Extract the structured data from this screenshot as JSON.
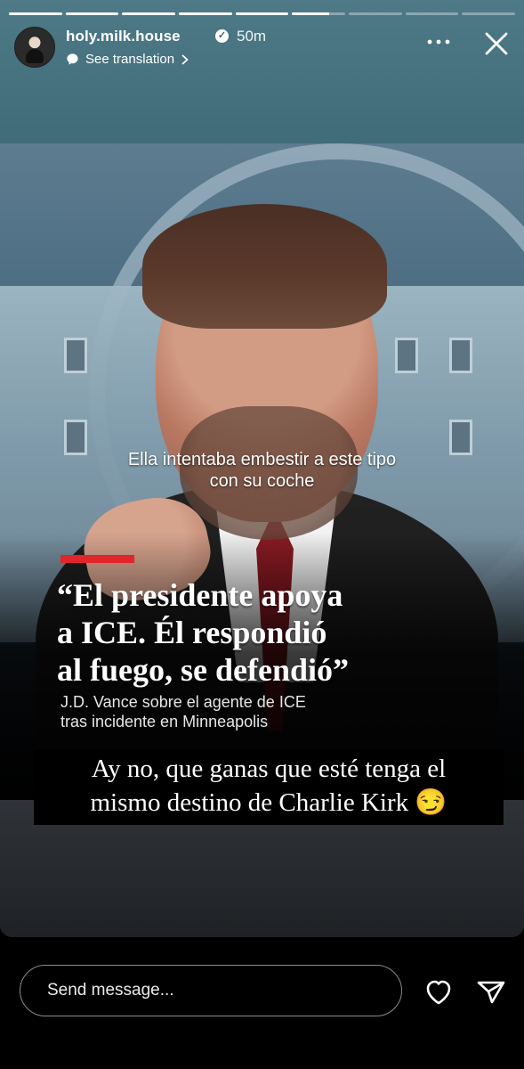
{
  "story": {
    "progress": {
      "segments": 9,
      "active_index": 5,
      "active_fraction": 0.7
    },
    "header": {
      "username": "holy.milk.house",
      "time_ago": "50m",
      "translation_label": "See translation"
    },
    "video": {
      "subtitle": "Ella intentaba embestir a este tipo\ncon su coche",
      "quote": "“El presidente apoya\na ICE. Él respondió\nal fuego, se defendió”",
      "caption": "J.D. Vance sobre el agente de ICE\ntras incidente en Minneapolis"
    },
    "overlay_caption": "Ay no, que ganas que esté tenga el\nmismo destino de Charlie Kirk 😏"
  },
  "composer": {
    "placeholder": "Send message..."
  },
  "icons": {
    "verified": "verified-badge-icon",
    "translation": "speech-bubble-icon",
    "chevron": "chevron-right-icon",
    "more": "more-horizontal-icon",
    "close": "close-icon",
    "like": "heart-icon",
    "send": "paper-plane-icon"
  },
  "colors": {
    "story_header_bg": "#4e7a87",
    "accent_red": "#e0262a",
    "background": "#000000"
  }
}
